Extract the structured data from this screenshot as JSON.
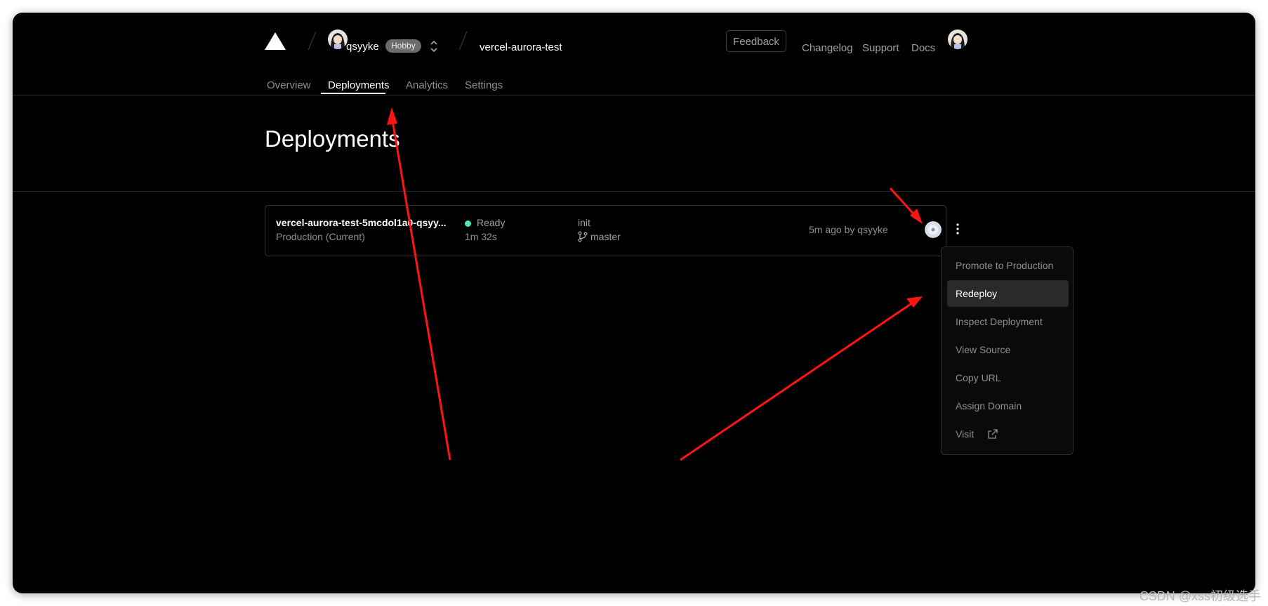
{
  "header": {
    "team_name": "qsyyke",
    "plan_badge": "Hobby",
    "project_name": "vercel-aurora-test",
    "feedback_label": "Feedback",
    "links": [
      "Changelog",
      "Support",
      "Docs"
    ]
  },
  "tabs": [
    {
      "label": "Overview",
      "active": false
    },
    {
      "label": "Deployments",
      "active": true
    },
    {
      "label": "Analytics",
      "active": false
    },
    {
      "label": "Settings",
      "active": false
    }
  ],
  "page": {
    "title": "Deployments"
  },
  "deployment": {
    "name": "vercel-aurora-test-5mcdol1a0-qsyy...",
    "environment": "Production (Current)",
    "status": "Ready",
    "status_color": "#50e3c2",
    "duration": "1m 32s",
    "commit": "init",
    "branch": "master",
    "meta": "5m ago by qsyyke"
  },
  "menu": {
    "items": [
      {
        "label": "Promote to Production",
        "active": false
      },
      {
        "label": "Redeploy",
        "active": true
      },
      {
        "label": "Inspect Deployment",
        "active": false
      },
      {
        "label": "View Source",
        "active": false
      },
      {
        "label": "Copy URL",
        "active": false
      },
      {
        "label": "Assign Domain",
        "active": false
      },
      {
        "label": "Visit",
        "active": false
      }
    ]
  },
  "watermark": "CSDN @xss初级选手",
  "icons": [
    "vercel-logo-icon",
    "avatar",
    "chevron-up-down-icon",
    "git-branch-icon",
    "more-vertical-icon",
    "external-link-icon"
  ],
  "colors": {
    "background": "#000000",
    "accent_ready": "#50e3c2",
    "annotation_arrow": "#ff0000"
  }
}
